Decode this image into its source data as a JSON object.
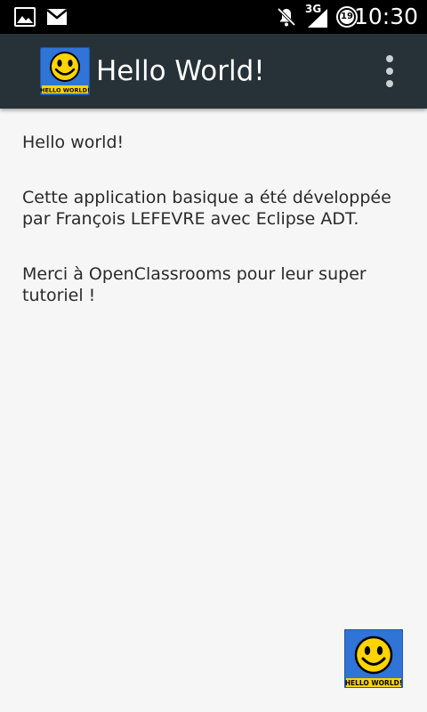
{
  "status_bar": {
    "time": "10:30",
    "network": "3G",
    "battery_level": "19",
    "icons": [
      "image-icon",
      "mail-icon",
      "notifications-off-icon",
      "signal-icon",
      "battery-icon"
    ]
  },
  "action_bar": {
    "title": "Hello World!",
    "app_icon_label": "HELLO WORLD!",
    "menu_icon": "more-vert-icon"
  },
  "content": {
    "paragraphs": [
      "Hello world!",
      "Cette application basique a été développée par François LEFEVRE avec Eclipse ADT.",
      "Merci à OpenClassrooms pour leur super tutoriel !"
    ]
  },
  "footer": {
    "icon_label": "HELLO WORLD!"
  },
  "colors": {
    "status_bar": "#000000",
    "action_bar": "#263238",
    "background": "#f6f6f6",
    "text": "#2a2a2a",
    "icon_blue": "#2f74d6",
    "icon_yellow": "#ffd400"
  }
}
